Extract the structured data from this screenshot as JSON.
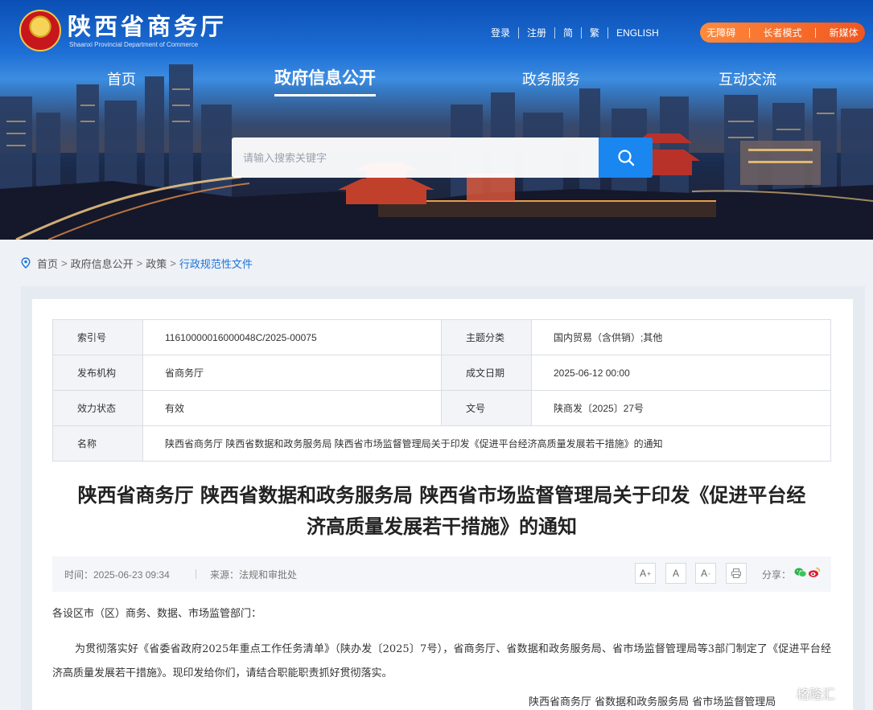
{
  "header": {
    "site_title": "陕西省商务厅",
    "site_subtitle": "Shaanxi Provincial Department of Commerce",
    "top_links": [
      "登录",
      "注册",
      "简",
      "繁",
      "ENGLISH"
    ],
    "special_links": [
      "无障碍",
      "长者模式",
      "新媒体"
    ],
    "accent_color": "#f0561e"
  },
  "nav": {
    "items": [
      {
        "label": "首页",
        "active": false
      },
      {
        "label": "政府信息公开",
        "active": true
      },
      {
        "label": "政务服务",
        "active": false
      },
      {
        "label": "互动交流",
        "active": false
      }
    ]
  },
  "search": {
    "placeholder": "请输入搜索关键字",
    "icon": "search-icon",
    "button_color": "#1a86f0"
  },
  "breadcrumb": {
    "icon": "location-pin-icon",
    "items": [
      "首页",
      "政府信息公开",
      "政策",
      "行政规范性文件"
    ],
    "separators": [
      ">",
      ">",
      ">"
    ]
  },
  "meta_table": {
    "rows": [
      [
        {
          "k": "索引号",
          "v": "11610000016000048C/2025-00075"
        },
        {
          "k": "主题分类",
          "v": "国内贸易（含供销）;其他"
        }
      ],
      [
        {
          "k": "发布机构",
          "v": "省商务厅"
        },
        {
          "k": "成文日期",
          "v": "2025-06-12 00:00"
        }
      ],
      [
        {
          "k": "效力状态",
          "v": "有效"
        },
        {
          "k": "文号",
          "v": "陕商发〔2025〕27号"
        }
      ]
    ],
    "name_row": {
      "k": "名称",
      "v": "陕西省商务厅 陕西省数据和政务服务局 陕西省市场监督管理局关于印发《促进平台经济高质量发展若干措施》的通知"
    }
  },
  "article": {
    "title_line1": "陕西省商务厅 陕西省数据和政务服务局 陕西省市场监督管理局关于印发《促进平台经",
    "title_line2": "济高质量发展若干措施》的通知",
    "time": "时间：2025-06-23 09:34",
    "source": "来源：法规和审批处",
    "font_buttons": [
      "A",
      "A",
      "A"
    ],
    "share_label": "分享：",
    "greeting": "各设区市（区）商务、数据、市场监管部门：",
    "paragraph": "为贯彻落实好《省委省政府2025年重点工作任务清单》（陕办发〔2025〕7号），省商务厅、省数据和政务服务局、省市场监督管理局等3部门制定了《促进平台经济高质量发展若干措施》。现印发给你们，请结合职能职责抓好贯彻落实。",
    "signature": "陕西省商务厅  省数据和政务服务局  省市场监督管理局"
  },
  "watermark": "格隆汇"
}
